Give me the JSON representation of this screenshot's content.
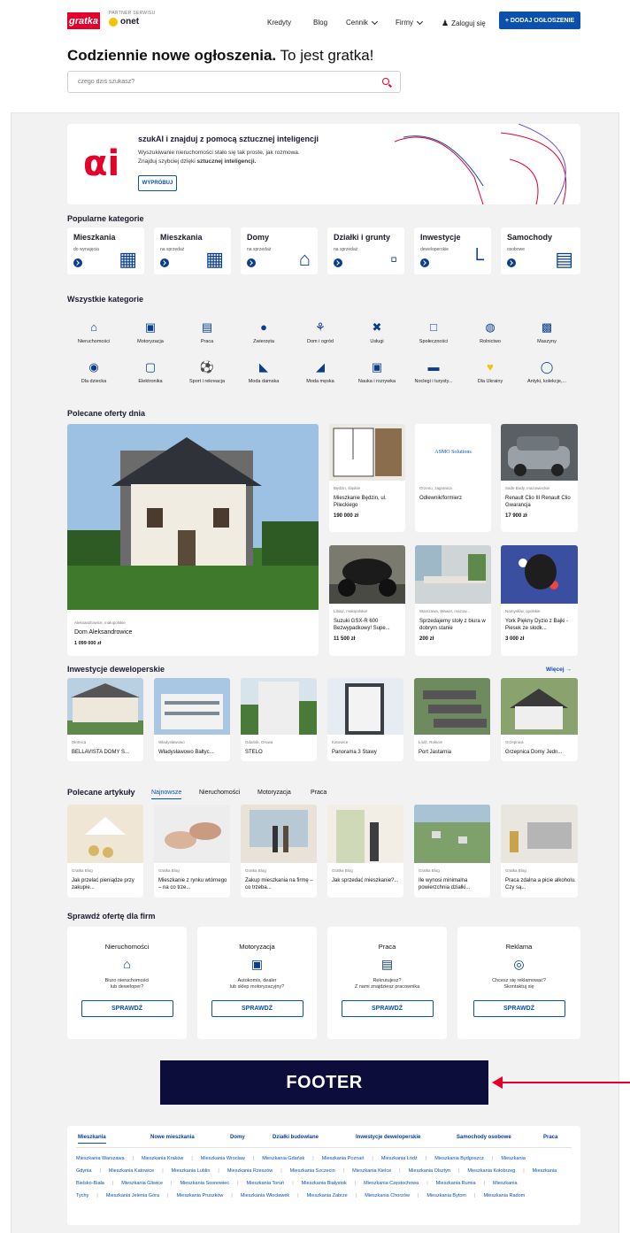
{
  "header": {
    "logo": "gratka",
    "partner": "PARTNER SERWISU",
    "partner_brand": "onet",
    "nav": [
      "Kredyty",
      "Blog",
      "Cennik",
      "Firmy",
      "Zaloguj się"
    ],
    "add_button": "+ DODAJ OGŁOSZENIE",
    "headline_bold": "Codziennie nowe ogłoszenia.",
    "headline_rest": " To jest gratka!",
    "search_placeholder": "czego dziś szukasz?"
  },
  "ai_banner": {
    "title": "szukAI i znajduj z pomocą sztucznej inteligencji",
    "line1": "Wyszukiwanie nieruchomości stało się tak proste, jak rozmowa.",
    "line2_a": "Znajduj szybciej dzięki ",
    "line2_b": "sztucznej inteligencji.",
    "button": "WYPRÓBUJ"
  },
  "popular": {
    "title": "Popularne kategorie",
    "items": [
      {
        "t": "Mieszkania",
        "s": "do wynajęcia",
        "icon": "building-icon"
      },
      {
        "t": "Mieszkania",
        "s": "na sprzedaż",
        "icon": "building-icon"
      },
      {
        "t": "Domy",
        "s": "na sprzedaż",
        "icon": "house-icon"
      },
      {
        "t": "Działki i grunty",
        "s": "na sprzedaż",
        "icon": "map-icon"
      },
      {
        "t": "Inwestycje",
        "s": "deweloperskie",
        "icon": "crane-icon"
      },
      {
        "t": "Samochody",
        "s": "osobowe",
        "icon": "car-icon"
      }
    ]
  },
  "all_categories": {
    "title": "Wszystkie kategorie",
    "items": [
      "Nieruchomości",
      "Motoryzacja",
      "Praca",
      "Zwierzęta",
      "Dom i ogród",
      "Usługi",
      "Społeczności",
      "Rolnictwo",
      "Maszyny",
      "Dla dziecka",
      "Elektronika",
      "Sport i rekreacja",
      "Moda damska",
      "Moda męska",
      "Nauka i rozrywka",
      "Noclegi i turysty...",
      "Dla Ukrainy",
      "Antyki, kolekcje,..."
    ]
  },
  "recommended": {
    "title": "Polecane oferty dnia",
    "featured": {
      "loc": "Aleksandrowice, małopolskie",
      "title": "Dom Aleksandrowice",
      "price": "1 099 000 zł"
    },
    "offers": [
      {
        "loc": "Będzin, śląskie",
        "title": "Mieszkanie Będzin, ul. Pileckiego",
        "price": "190 000 zł"
      },
      {
        "loc": "Orzeno, zagranica",
        "title": "Odlewnik/formierz",
        "price": ""
      },
      {
        "loc": "Sade Budy, mazowieckie",
        "title": "Renault Clio III Renault Clio Gwarancja",
        "price": "17 900 zł"
      },
      {
        "loc": "Libiąż, małopolskie",
        "title": "Suzuki GSX-R 600 Bezwypadkowy! Supe...",
        "price": "11 500 zł"
      },
      {
        "loc": "Warszawa, Wawer, mazow...",
        "title": "Sprzedajemy stoły z biura w dobrym stanie",
        "price": "200 zł"
      },
      {
        "loc": "Namysłów, opolskie",
        "title": "York Piękny Dyzio z Bajki - Piesek ze słodk...",
        "price": "3 000 zł"
      }
    ],
    "asmo_logo": "ASMO Solutions"
  },
  "investments": {
    "title": "Inwestycje deweloperskie",
    "more": "Więcej",
    "items": [
      {
        "loc": "Dłotnica",
        "title": "BELLAVISTA DOMY S..."
      },
      {
        "loc": "Władysławowo",
        "title": "Władysławowo Bałtyc..."
      },
      {
        "loc": "Gdańsk, Oruwa",
        "title": "STELO"
      },
      {
        "loc": "Katowice",
        "title": "Panorama 3 Stawy"
      },
      {
        "loc": "Łódź, Rokicie",
        "title": "Port Jastarnia"
      },
      {
        "loc": "Grzepnica",
        "title": "Grzepnica Domy Jedn..."
      }
    ]
  },
  "articles": {
    "title": "Polecane artykuły",
    "tabs": [
      "Najnowsze",
      "Nieruchomości",
      "Motoryzacja",
      "Praca"
    ],
    "items": [
      {
        "src": "Gratka Blog",
        "title": "Jak przelać pieniądze przy zakupie..."
      },
      {
        "src": "Gratka Blog",
        "title": "Mieszkanie z rynku wtórnego – na co trze..."
      },
      {
        "src": "Gratka Blog",
        "title": "Zakup mieszkania na firmę – co trzeba..."
      },
      {
        "src": "Gratka Blog",
        "title": "Jak sprzedać mieszkanie?..."
      },
      {
        "src": "Gratka Blog",
        "title": "Ile wynosi minimalna powierzchnia działki..."
      },
      {
        "src": "Gratka Blog",
        "title": "Praca zdalna a picie alkoholu. Czy są..."
      }
    ]
  },
  "business": {
    "title": "Sprawdź ofertę dla firm",
    "cards": [
      {
        "h": "Nieruchomości",
        "d1": "Biuro nieruchomości",
        "d2": "lub deweloper?",
        "btn": "SPRAWDŹ",
        "icon": "house-icon"
      },
      {
        "h": "Motoryzacja",
        "d1": "Autokomis, dealer",
        "d2": "lub sklep motoryzacyjny?",
        "btn": "SPRAWDŹ",
        "icon": "car-icon"
      },
      {
        "h": "Praca",
        "d1": "Rekrutujesz?",
        "d2": "Z nami znajdziesz pracownika",
        "btn": "SPRAWDŹ",
        "icon": "briefcase-icon"
      },
      {
        "h": "Reklama",
        "d1": "Chcesz się reklamować?",
        "d2": "Skontaktuj się",
        "btn": "SPRAWDŹ",
        "icon": "target-icon"
      }
    ]
  },
  "footer_label": "FOOTER",
  "footer": {
    "tabs": [
      "Mieszkania",
      "Nowe mieszkania",
      "Domy",
      "Działki budowlane",
      "Inwestycje deweloperskie",
      "Samochody osobowe",
      "Praca"
    ],
    "links": [
      "Mieszkania Warszawa",
      "Mieszkania Kraków",
      "Mieszkania Wrocław",
      "Mieszkania Gdańsk",
      "Mieszkania Poznań",
      "Mieszkania Łódź",
      "Mieszkania Bydgoszcz",
      "Mieszkania Gdynia",
      "Mieszkania Katowice",
      "Mieszkania Lublin",
      "Mieszkania Rzeszów",
      "Mieszkania Szczecin",
      "Mieszkania Kielce",
      "Mieszkania Olsztyn",
      "Mieszkania Kołobrzeg",
      "Mieszkania Bielsko-Biała",
      "Mieszkania Gliwice",
      "Mieszkania Sosnowiec",
      "Mieszkania Toruń",
      "Mieszkania Białystok",
      "Mieszkania Częstochowa",
      "Mieszkania Rumia",
      "Mieszkania Tychy",
      "Mieszkania Jelenia Góra",
      "Mieszkania Pruszków",
      "Mieszkania Włocławek",
      "Mieszkania Zabrze",
      "Mieszkania Chorzów",
      "Mieszkania Bytom",
      "Mieszkania Radom"
    ]
  },
  "colors": {
    "brand_red": "#e4002b",
    "primary_blue": "#0a50b0",
    "navy": "#0d0d3b"
  }
}
